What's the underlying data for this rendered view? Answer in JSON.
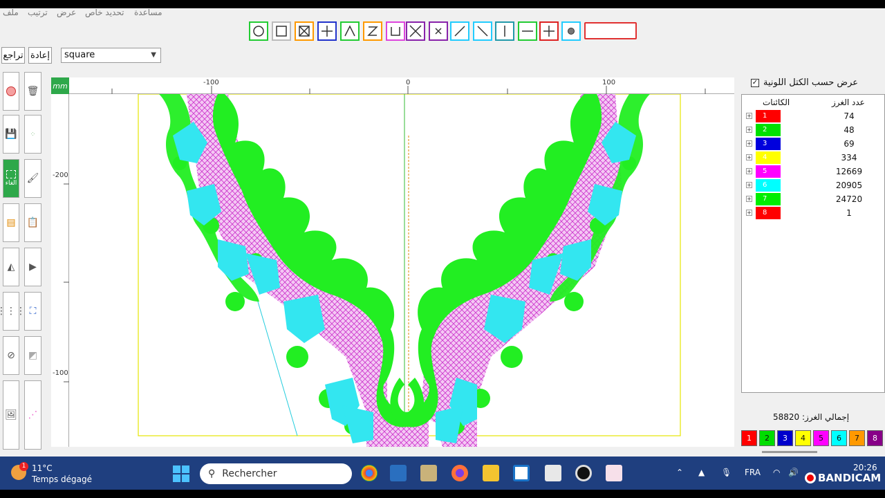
{
  "menu": [
    "ملف",
    "ترتيب",
    "عرض",
    "تحديد خاص",
    "مساعدة"
  ],
  "toolbar": {
    "undo_label": "تراجع",
    "redo_label": "إعادة",
    "shape_select_value": "square"
  },
  "shapes": [
    {
      "name": "circle",
      "color": "#22cc33"
    },
    {
      "name": "square",
      "color": "#aaaaaa"
    },
    {
      "name": "box-x",
      "color": "#ff9900"
    },
    {
      "name": "plus",
      "color": "#2233cc"
    },
    {
      "name": "caret",
      "color": "#22cc33"
    },
    {
      "name": "z",
      "color": "#ff9900"
    },
    {
      "name": "u",
      "color": "#dd44dd"
    },
    {
      "name": "x-large",
      "color": "#8822aa"
    },
    {
      "name": "x-small",
      "color": "#8822aa"
    },
    {
      "name": "slash",
      "color": "#22ccff"
    },
    {
      "name": "backslash",
      "color": "#22ccff"
    },
    {
      "name": "vertical",
      "color": "#2299aa"
    },
    {
      "name": "minus",
      "color": "#22cc33"
    },
    {
      "name": "cross",
      "color": "#dd2222"
    },
    {
      "name": "dot",
      "color": "#22ccff"
    }
  ],
  "tools": {
    "fill_label": "الغاء"
  },
  "ruler": {
    "unit": "mm",
    "top_ticks": [
      "-100",
      "0",
      "100"
    ],
    "left_ticks": [
      "-200",
      "-100"
    ]
  },
  "right_panel": {
    "show_by_blocks_label": "عرض حسب الكتل اللونية",
    "show_by_blocks_checked": true,
    "col_objects": "الكائنات",
    "col_stitches": "عدد الغرز",
    "rows": [
      {
        "id": "1",
        "color": "#ff0000",
        "stitches": "74"
      },
      {
        "id": "2",
        "color": "#00e000",
        "stitches": "48"
      },
      {
        "id": "3",
        "color": "#0000dd",
        "stitches": "69"
      },
      {
        "id": "4",
        "color": "#ffff00",
        "stitches": "334"
      },
      {
        "id": "5",
        "color": "#ff00ff",
        "stitches": "12669"
      },
      {
        "id": "6",
        "color": "#00ffff",
        "stitches": "20905"
      },
      {
        "id": "7",
        "color": "#00ee00",
        "stitches": "24720"
      },
      {
        "id": "8",
        "color": "#ff0000",
        "stitches": "1"
      }
    ],
    "total_label": "إجمالي الغرز: 58820",
    "palette": [
      {
        "id": "1",
        "color": "#ff0000"
      },
      {
        "id": "2",
        "color": "#00dd00"
      },
      {
        "id": "3",
        "color": "#0000cc"
      },
      {
        "id": "4",
        "color": "#ffff00"
      },
      {
        "id": "5",
        "color": "#ff00ff"
      },
      {
        "id": "6",
        "color": "#00ffff"
      },
      {
        "id": "7",
        "color": "#ff9900"
      },
      {
        "id": "8",
        "color": "#880088"
      }
    ]
  },
  "taskbar": {
    "weather_temp": "11°C",
    "weather_desc": "Temps dégagé",
    "weather_badge": "1",
    "search_placeholder": "Rechercher",
    "lang": "FRA",
    "time": "20:26",
    "recorder": "BANDICAM"
  }
}
